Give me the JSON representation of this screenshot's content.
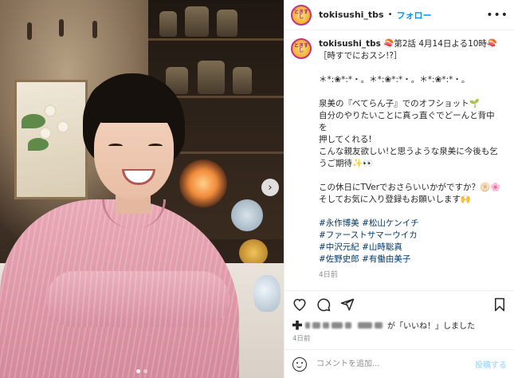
{
  "post": {
    "account": "tokisushi_tbs",
    "separator": "•",
    "follow_label": "フォロー",
    "more_label": "•••",
    "avatar_text": "ときすし"
  },
  "caption": {
    "username": "tokisushi_tbs",
    "lines": [
      "🍣第2話 4月14日よる10時🍣",
      "［時すでにおスシ!?］",
      "",
      "＊*:❀*:*・。＊*:❀*:*・。＊*:❀*:*・。",
      "",
      "泉美の『べてらん子』でのオフショット🌱",
      "自分のやりたいことに真っ直ぐでどーんと背中を",
      "押してくれる!",
      "こんな親友欲しい!と思うような泉美に今後も乞",
      "うご期待✨👀",
      "",
      "この休日にTVerでおさらいいかがですか？🫓🌸",
      "そしてお気に入り登録もお願いします🙌"
    ],
    "hashtags": [
      "#永作博美 #松山ケンイチ",
      "#ファーストサマーウイカ",
      "#中沢元紀 #山時聡真",
      "#佐野史郎 #有働由美子"
    ],
    "time": "4日前"
  },
  "likes": {
    "text": "が「いいね！」しました",
    "time": "4日前"
  },
  "comment": {
    "placeholder": "コメントを追加...",
    "post_label": "投稿する"
  },
  "icons": {
    "like": "heart-icon",
    "comment": "comment-icon",
    "share": "share-icon",
    "save": "bookmark-icon",
    "emoji": "emoji-icon",
    "next": "chevron-right-icon"
  },
  "carousel": {
    "current": 1,
    "total": 2
  },
  "colors": {
    "link": "#00376b",
    "follow": "#0095f6",
    "muted": "#8e8e8e",
    "shirt": "#e9a9b6"
  }
}
